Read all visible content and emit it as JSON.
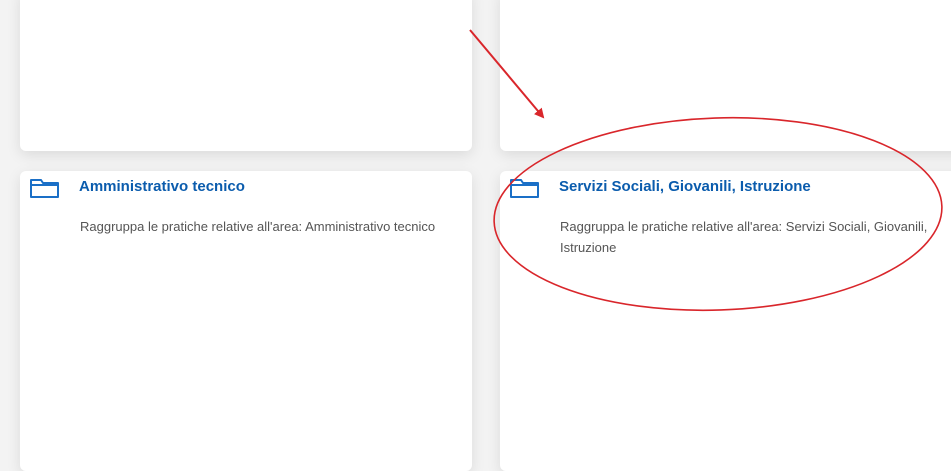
{
  "cards": [
    {
      "title": "Amministrativo tecnico",
      "description": "Raggruppa le pratiche relative all'area: Amministrativo tecnico",
      "icon": "folder-icon"
    },
    {
      "title": "Servizi Sociali, Giovanili, Istruzione",
      "description": "Raggruppa le pratiche relative all'area: Servizi Sociali, Giovanili, Istruzione",
      "icon": "folder-icon"
    }
  ],
  "colors": {
    "title": "#0b5cad",
    "icon": "#1a6fc7",
    "annotation": "#d9262b",
    "description": "#555555",
    "background": "#f3f3f3",
    "card": "#ffffff"
  }
}
